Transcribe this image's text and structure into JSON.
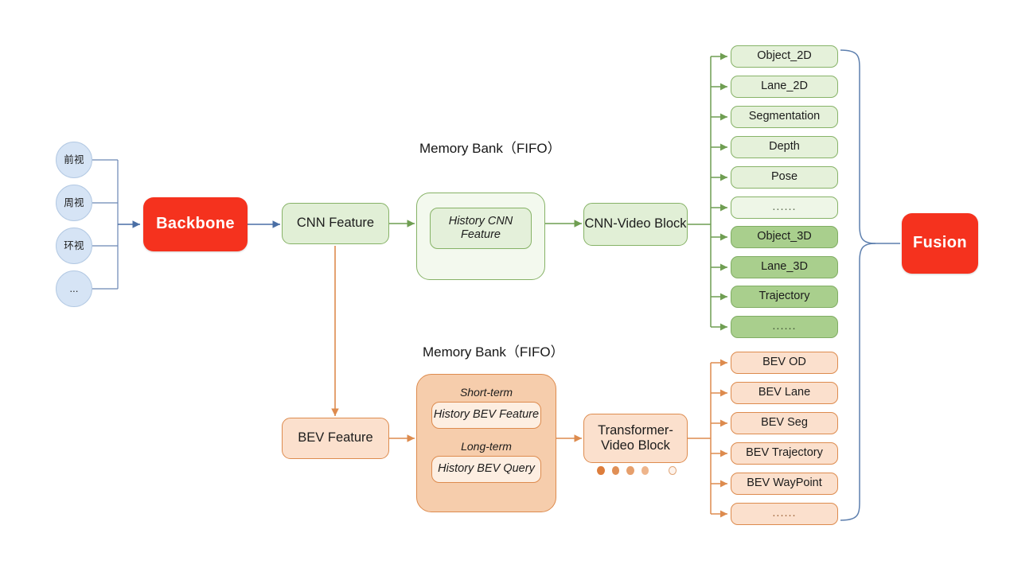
{
  "diagram": {
    "title_cnn_bank": "Memory Bank（FIFO）",
    "title_bev_bank": "Memory Bank（FIFO）"
  },
  "inputs": {
    "cameras": [
      {
        "label": "前视",
        "name": "front-view"
      },
      {
        "label": "周视",
        "name": "surround-view"
      },
      {
        "label": "环视",
        "name": "around-view"
      },
      {
        "label": "...",
        "name": "more-views"
      }
    ]
  },
  "backbone": {
    "label": "Backbone",
    "color": "#f5321e"
  },
  "fusion": {
    "label": "Fusion",
    "color": "#f5321e"
  },
  "cnn_branch": {
    "feature_label": "CNN Feature",
    "bank_inner_label": "History CNN Feature",
    "block_label": "CNN-Video Block",
    "accent": "#86b266"
  },
  "bev_branch": {
    "feature_label": "BEV Feature",
    "short_term_label": "Short-term",
    "short_term_item": "History BEV Feature",
    "long_term_label": "Long-term",
    "long_term_item": "History BEV Query",
    "block_label": "Transformer-Video Block",
    "accent": "#dd8b4e"
  },
  "outputs_2d3d": [
    {
      "label": "Object_2D",
      "tier": "2d"
    },
    {
      "label": "Lane_2D",
      "tier": "2d"
    },
    {
      "label": "Segmentation",
      "tier": "2d"
    },
    {
      "label": "Depth",
      "tier": "2d"
    },
    {
      "label": "Pose",
      "tier": "2d"
    },
    {
      "label": "......",
      "tier": "2d-ellipsis"
    },
    {
      "label": "Object_3D",
      "tier": "3d"
    },
    {
      "label": "Lane_3D",
      "tier": "3d"
    },
    {
      "label": "Trajectory",
      "tier": "3d"
    },
    {
      "label": "......",
      "tier": "3d-ellipsis"
    }
  ],
  "outputs_bev": [
    {
      "label": "BEV OD",
      "tier": "bev"
    },
    {
      "label": "BEV Lane",
      "tier": "bev"
    },
    {
      "label": "BEV Seg",
      "tier": "bev"
    },
    {
      "label": "BEV Trajectory",
      "tier": "bev"
    },
    {
      "label": "BEV WayPoint",
      "tier": "bev"
    },
    {
      "label": "......",
      "tier": "bev-ellipsis"
    }
  ],
  "sequence_dots": {
    "count": 5,
    "name": "temporal-sequence-dots"
  }
}
